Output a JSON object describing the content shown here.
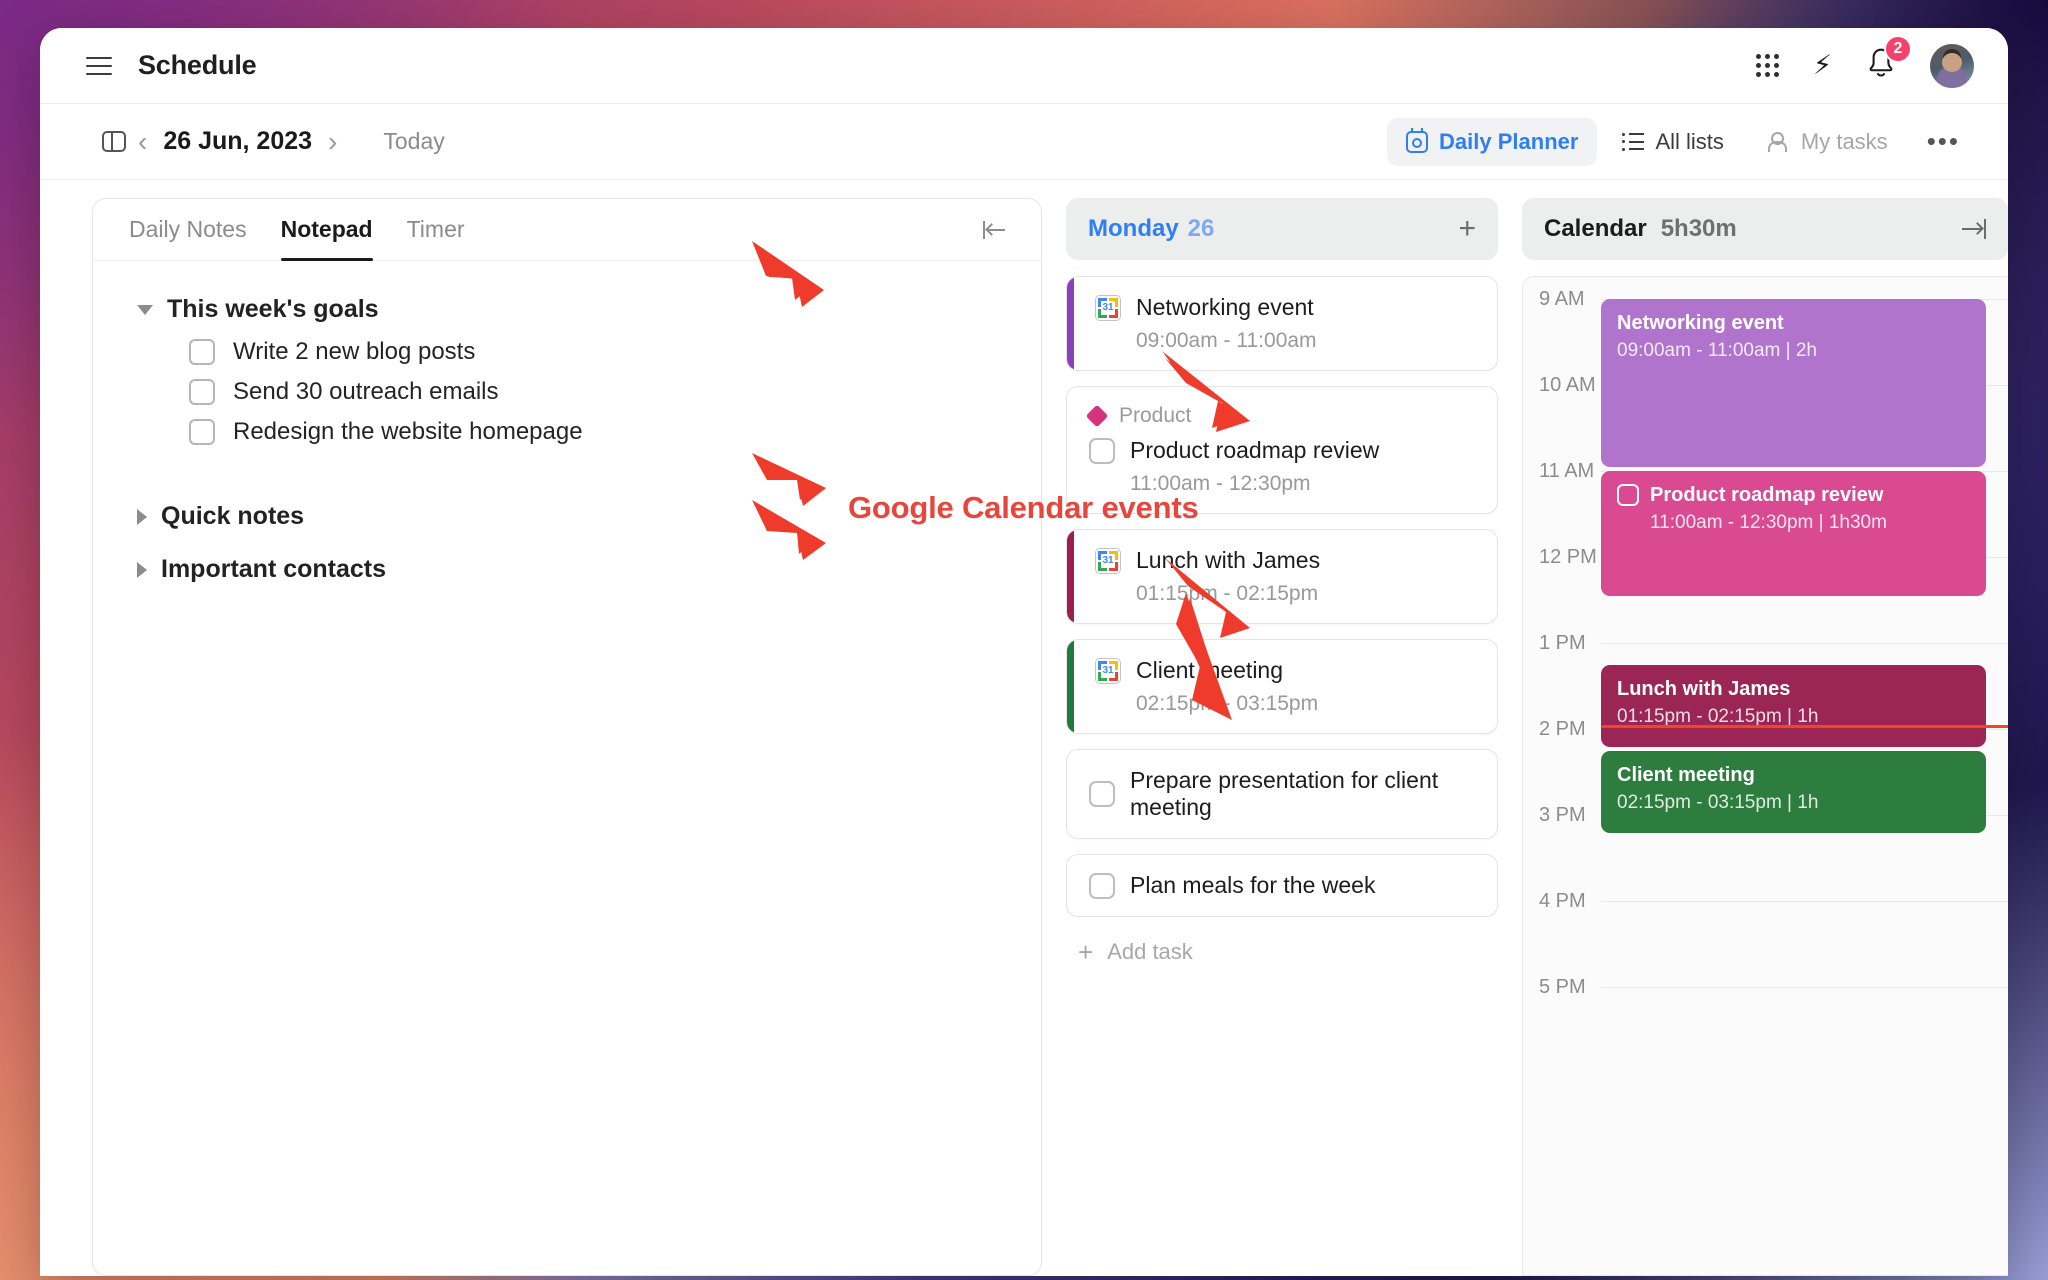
{
  "topbar": {
    "title": "Schedule",
    "menu_icon": "hamburger-icon",
    "apps_icon": "grid-apps-icon",
    "bolt_icon": "lightning-bolt-icon",
    "bell_icon": "bell-icon",
    "notification_count": "2",
    "avatar": "user-avatar"
  },
  "toolbar": {
    "panel_toggle_icon": "sidebar-panel-icon",
    "prev_label": "‹",
    "next_label": "›",
    "current_date": "26 Jun, 2023",
    "today_label": "Today",
    "views": [
      {
        "label": "Daily Planner",
        "icon": "calendar-icon",
        "state": "active"
      },
      {
        "label": "All lists",
        "icon": "list-icon",
        "state": "normal"
      },
      {
        "label": "My tasks",
        "icon": "people-icon",
        "state": "muted"
      }
    ],
    "more_label": "•••"
  },
  "notepad": {
    "tabs": [
      {
        "label": "Daily Notes",
        "active": false
      },
      {
        "label": "Notepad",
        "active": true
      },
      {
        "label": "Timer",
        "active": false
      }
    ],
    "collapse_icon": "collapse-left-icon",
    "groups": [
      {
        "title": "This week's goals",
        "expanded": true,
        "items": [
          "Write 2 new blog posts",
          "Send 30 outreach emails",
          "Redesign the website homepage"
        ]
      },
      {
        "title": "Quick notes",
        "expanded": false,
        "items": []
      },
      {
        "title": "Important contacts",
        "expanded": false,
        "items": []
      }
    ]
  },
  "tasks_column": {
    "day_name": "Monday",
    "day_number": "26",
    "add_icon": "plus-icon",
    "add_task_label": "Add task",
    "tasks": [
      {
        "title": "Networking event",
        "time": "09:00am - 11:00am",
        "source": "google-calendar",
        "bar_color": "#8b3fb8",
        "has_checkbox": false,
        "tag": null
      },
      {
        "title": "Product roadmap review",
        "time": "11:00am - 12:30pm",
        "source": "task",
        "bar_color": null,
        "has_checkbox": true,
        "tag": {
          "label": "Product",
          "color": "#d6327f"
        }
      },
      {
        "title": "Lunch with James",
        "time": "01:15pm - 02:15pm",
        "source": "google-calendar",
        "bar_color": "#9c1f50",
        "has_checkbox": false,
        "tag": null
      },
      {
        "title": "Client meeting",
        "time": "02:15pm - 03:15pm",
        "source": "google-calendar",
        "bar_color": "#1f7a3c",
        "has_checkbox": false,
        "tag": null
      },
      {
        "title": "Prepare presentation for client meeting",
        "time": null,
        "source": "task",
        "bar_color": null,
        "has_checkbox": true,
        "tag": null
      },
      {
        "title": "Plan meals for the week",
        "time": null,
        "source": "task",
        "bar_color": null,
        "has_checkbox": true,
        "tag": null
      }
    ]
  },
  "calendar": {
    "title": "Calendar",
    "total_duration": "5h30m",
    "expand_icon": "expand-right-icon",
    "hours": [
      "9 AM",
      "10 AM",
      "11 AM",
      "12 PM",
      "1 PM",
      "2 PM",
      "3 PM",
      "4 PM",
      "5 PM"
    ],
    "events": [
      {
        "title": "Networking event",
        "time": "09:00am - 11:00am | 2h",
        "color": "#b174cd",
        "start_hour": 9.0,
        "end_hour": 11.0,
        "has_checkbox": false
      },
      {
        "title": "Product roadmap review",
        "time": "11:00am - 12:30pm | 1h30m",
        "color": "#d94a92",
        "start_hour": 11.0,
        "end_hour": 12.5,
        "has_checkbox": true
      },
      {
        "title": "Lunch with James",
        "time": "01:15pm - 02:15pm | 1h",
        "color": "#9b2656",
        "start_hour": 13.25,
        "end_hour": 14.25,
        "has_checkbox": false
      },
      {
        "title": "Client meeting",
        "time": "02:15pm - 03:15pm | 1h",
        "color": "#2d7d3f",
        "start_hour": 14.25,
        "end_hour": 15.25,
        "has_checkbox": false
      }
    ],
    "now_indicator": {
      "color": "#f4451f",
      "hour": 13.95
    }
  },
  "annotations": {
    "label": "Google Calendar events",
    "color": "#e8453c"
  }
}
